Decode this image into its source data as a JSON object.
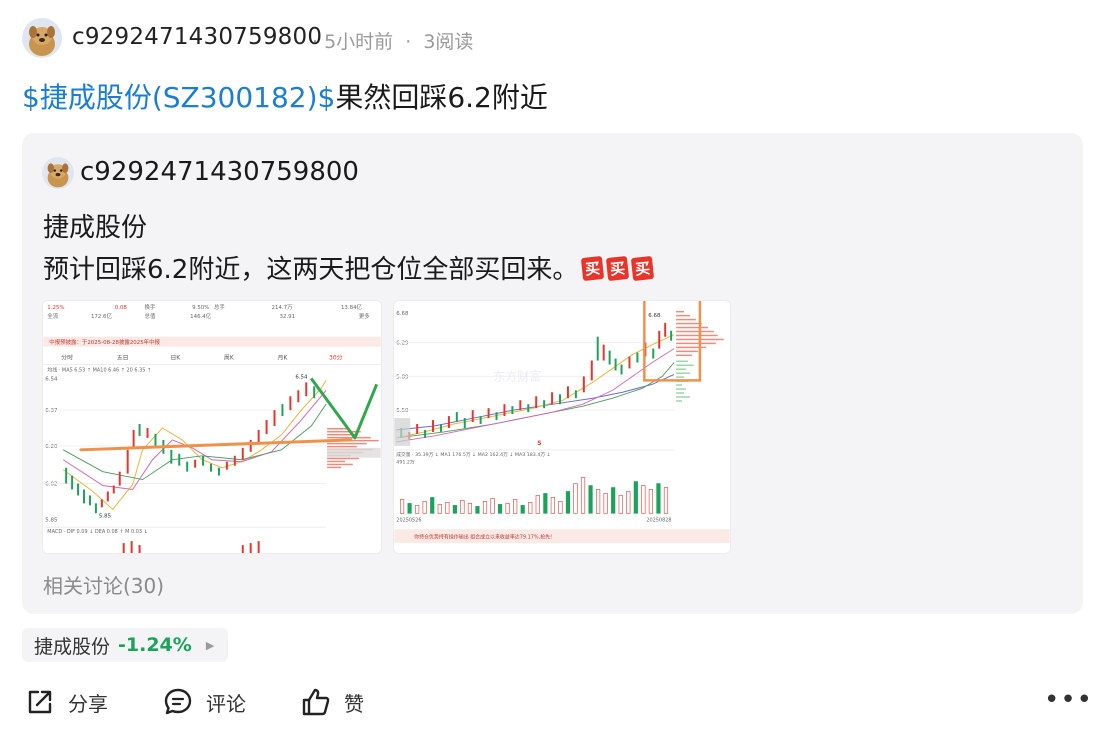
{
  "post": {
    "author": "c9292471430759800",
    "time": "5小时前",
    "reads": "3阅读",
    "dot": "·",
    "stock_link": "$捷成股份(SZ300182)$",
    "text": "果然回踩6.2附近"
  },
  "quote": {
    "author": "c9292471430759800",
    "line1": "捷成股份",
    "line2": "预计回踩6.2附近，这两天把仓位全部买回来。",
    "emoji": [
      "买",
      "买",
      "买"
    ],
    "related": "相关讨论(30)"
  },
  "chart1": {
    "stats": [
      "1.25%",
      "0.08",
      "换手",
      "9.50%",
      "总手",
      "214.7万",
      "13.84亿",
      "全流",
      "172.6亿",
      "总值",
      "146.4亿",
      "32.91",
      "更多"
    ],
    "notice": "中报预披露：于2025-08-28披露2025年中报",
    "tabs": [
      "分时",
      "五日",
      "日K",
      "周K",
      "月K",
      "30分"
    ],
    "y_ticks": [
      "6.54",
      "6.37",
      "6.20",
      "6.02",
      "5.85"
    ],
    "ma_text": "均线 · MA5 6.53 ↑  MA10 6.46 ↑  20 6.35 ↑",
    "low_label": "5.85",
    "bottom_text": "MACD · DIF 0.09 ↓  DEA 0.08 ↑  M 0.03 ↓"
  },
  "chart2": {
    "y_ticks": [
      "6.68",
      "6.29",
      "5.89",
      "5.50"
    ],
    "top_label": "6.68",
    "vol_text": "成交量 · 35.39万 ↓  MA1 176.5万 ↓  MA2 162.4万 ↓  MA3 183.4万 ↓",
    "vol_sub": "491.2万",
    "dates": [
      "20250526",
      "20250828"
    ],
    "banner": "你持仓优势持有操作输出 组合成立以来收益率达79.17%,抢先!",
    "watermark": "东方财富"
  },
  "stock_tag": {
    "name": "捷成股份",
    "change": "-1.24%",
    "arrow": "▶"
  },
  "actions": {
    "share": "分享",
    "comment": "评论",
    "like": "赞",
    "more": "•••"
  },
  "colors": {
    "link": "#1a7fd4",
    "up": "#e7352b",
    "down": "#1aa35a",
    "card_bg": "#f4f4f6"
  },
  "icons": [
    "avatar-dog",
    "share-icon",
    "comment-icon",
    "like-icon",
    "more-icon"
  ]
}
